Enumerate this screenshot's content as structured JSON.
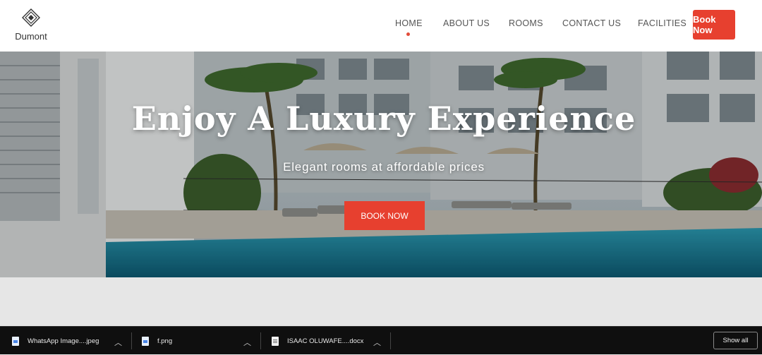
{
  "brand": {
    "name": "Dumont"
  },
  "nav": {
    "items": [
      {
        "label": "HOME",
        "active": true
      },
      {
        "label": "ABOUT US"
      },
      {
        "label": "ROOMS"
      },
      {
        "label": "CONTACT US"
      },
      {
        "label": "FACILITIES"
      }
    ],
    "cta_label": "Book Now"
  },
  "hero": {
    "title": "Enjoy A Luxury Experience",
    "subtitle": "Elegant rooms at affordable prices",
    "button_label": "BOOK NOW"
  },
  "downloads": {
    "items": [
      {
        "name": "WhatsApp Image....jpeg",
        "icon": "image-file-icon"
      },
      {
        "name": "f.png",
        "icon": "image-file-icon"
      },
      {
        "name": "ISAAC OLUWAFE....docx",
        "icon": "document-file-icon"
      }
    ],
    "show_all_label": "Show all"
  },
  "colors": {
    "accent": "#e7402f",
    "header_bg": "#ffffff",
    "download_bar_bg": "#0f0f0f"
  }
}
